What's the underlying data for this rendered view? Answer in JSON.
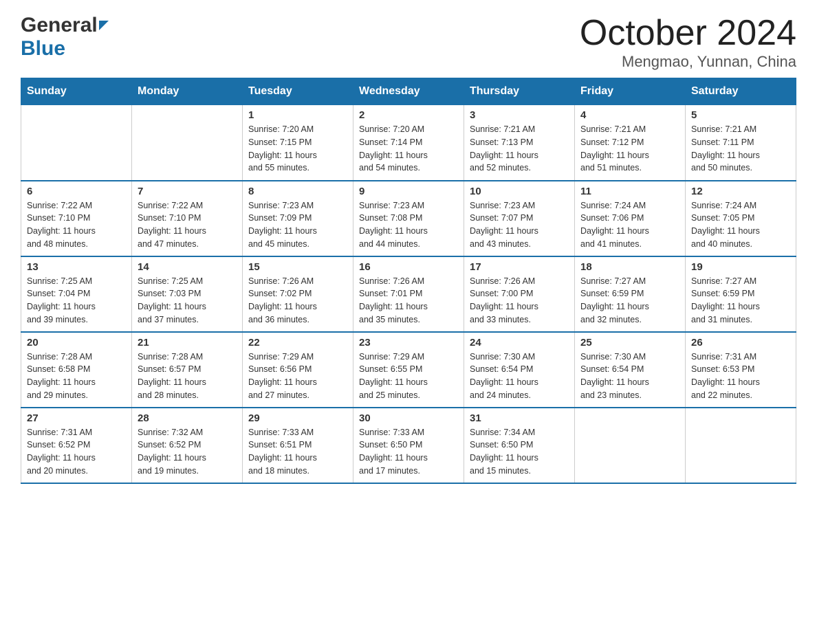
{
  "header": {
    "logo_general": "General",
    "logo_blue": "Blue",
    "month_title": "October 2024",
    "location": "Mengmao, Yunnan, China"
  },
  "days_of_week": [
    "Sunday",
    "Monday",
    "Tuesday",
    "Wednesday",
    "Thursday",
    "Friday",
    "Saturday"
  ],
  "weeks": [
    [
      {
        "day": "",
        "info": ""
      },
      {
        "day": "",
        "info": ""
      },
      {
        "day": "1",
        "info": "Sunrise: 7:20 AM\nSunset: 7:15 PM\nDaylight: 11 hours\nand 55 minutes."
      },
      {
        "day": "2",
        "info": "Sunrise: 7:20 AM\nSunset: 7:14 PM\nDaylight: 11 hours\nand 54 minutes."
      },
      {
        "day": "3",
        "info": "Sunrise: 7:21 AM\nSunset: 7:13 PM\nDaylight: 11 hours\nand 52 minutes."
      },
      {
        "day": "4",
        "info": "Sunrise: 7:21 AM\nSunset: 7:12 PM\nDaylight: 11 hours\nand 51 minutes."
      },
      {
        "day": "5",
        "info": "Sunrise: 7:21 AM\nSunset: 7:11 PM\nDaylight: 11 hours\nand 50 minutes."
      }
    ],
    [
      {
        "day": "6",
        "info": "Sunrise: 7:22 AM\nSunset: 7:10 PM\nDaylight: 11 hours\nand 48 minutes."
      },
      {
        "day": "7",
        "info": "Sunrise: 7:22 AM\nSunset: 7:10 PM\nDaylight: 11 hours\nand 47 minutes."
      },
      {
        "day": "8",
        "info": "Sunrise: 7:23 AM\nSunset: 7:09 PM\nDaylight: 11 hours\nand 45 minutes."
      },
      {
        "day": "9",
        "info": "Sunrise: 7:23 AM\nSunset: 7:08 PM\nDaylight: 11 hours\nand 44 minutes."
      },
      {
        "day": "10",
        "info": "Sunrise: 7:23 AM\nSunset: 7:07 PM\nDaylight: 11 hours\nand 43 minutes."
      },
      {
        "day": "11",
        "info": "Sunrise: 7:24 AM\nSunset: 7:06 PM\nDaylight: 11 hours\nand 41 minutes."
      },
      {
        "day": "12",
        "info": "Sunrise: 7:24 AM\nSunset: 7:05 PM\nDaylight: 11 hours\nand 40 minutes."
      }
    ],
    [
      {
        "day": "13",
        "info": "Sunrise: 7:25 AM\nSunset: 7:04 PM\nDaylight: 11 hours\nand 39 minutes."
      },
      {
        "day": "14",
        "info": "Sunrise: 7:25 AM\nSunset: 7:03 PM\nDaylight: 11 hours\nand 37 minutes."
      },
      {
        "day": "15",
        "info": "Sunrise: 7:26 AM\nSunset: 7:02 PM\nDaylight: 11 hours\nand 36 minutes."
      },
      {
        "day": "16",
        "info": "Sunrise: 7:26 AM\nSunset: 7:01 PM\nDaylight: 11 hours\nand 35 minutes."
      },
      {
        "day": "17",
        "info": "Sunrise: 7:26 AM\nSunset: 7:00 PM\nDaylight: 11 hours\nand 33 minutes."
      },
      {
        "day": "18",
        "info": "Sunrise: 7:27 AM\nSunset: 6:59 PM\nDaylight: 11 hours\nand 32 minutes."
      },
      {
        "day": "19",
        "info": "Sunrise: 7:27 AM\nSunset: 6:59 PM\nDaylight: 11 hours\nand 31 minutes."
      }
    ],
    [
      {
        "day": "20",
        "info": "Sunrise: 7:28 AM\nSunset: 6:58 PM\nDaylight: 11 hours\nand 29 minutes."
      },
      {
        "day": "21",
        "info": "Sunrise: 7:28 AM\nSunset: 6:57 PM\nDaylight: 11 hours\nand 28 minutes."
      },
      {
        "day": "22",
        "info": "Sunrise: 7:29 AM\nSunset: 6:56 PM\nDaylight: 11 hours\nand 27 minutes."
      },
      {
        "day": "23",
        "info": "Sunrise: 7:29 AM\nSunset: 6:55 PM\nDaylight: 11 hours\nand 25 minutes."
      },
      {
        "day": "24",
        "info": "Sunrise: 7:30 AM\nSunset: 6:54 PM\nDaylight: 11 hours\nand 24 minutes."
      },
      {
        "day": "25",
        "info": "Sunrise: 7:30 AM\nSunset: 6:54 PM\nDaylight: 11 hours\nand 23 minutes."
      },
      {
        "day": "26",
        "info": "Sunrise: 7:31 AM\nSunset: 6:53 PM\nDaylight: 11 hours\nand 22 minutes."
      }
    ],
    [
      {
        "day": "27",
        "info": "Sunrise: 7:31 AM\nSunset: 6:52 PM\nDaylight: 11 hours\nand 20 minutes."
      },
      {
        "day": "28",
        "info": "Sunrise: 7:32 AM\nSunset: 6:52 PM\nDaylight: 11 hours\nand 19 minutes."
      },
      {
        "day": "29",
        "info": "Sunrise: 7:33 AM\nSunset: 6:51 PM\nDaylight: 11 hours\nand 18 minutes."
      },
      {
        "day": "30",
        "info": "Sunrise: 7:33 AM\nSunset: 6:50 PM\nDaylight: 11 hours\nand 17 minutes."
      },
      {
        "day": "31",
        "info": "Sunrise: 7:34 AM\nSunset: 6:50 PM\nDaylight: 11 hours\nand 15 minutes."
      },
      {
        "day": "",
        "info": ""
      },
      {
        "day": "",
        "info": ""
      }
    ]
  ]
}
